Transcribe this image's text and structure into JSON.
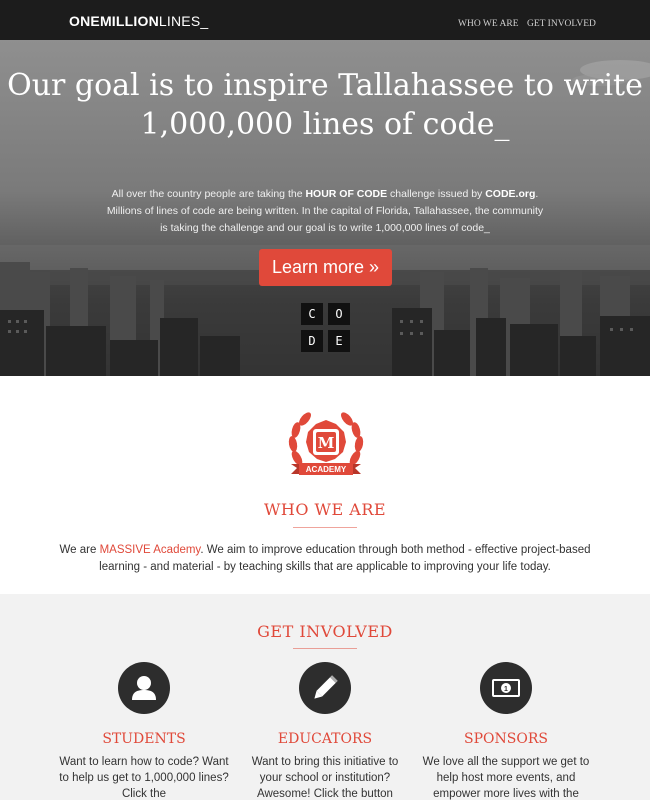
{
  "nav": {
    "brand_bold": "ONEMILLION",
    "brand_light": "LINES_",
    "links": [
      "WHO WE ARE",
      "GET INVOLVED"
    ]
  },
  "hero": {
    "title": "Our goal is to inspire Tallahassee to write 1,000,000 lines of code_",
    "text_parts": [
      "All over the country people are taking the ",
      "HOUR OF CODE",
      " challenge issued by ",
      "CODE.org",
      ". Millions of lines of code are being written. In the capital of Florida, Tallahassee, the community is taking the challenge and our goal is to write 1,000,000 lines of code_"
    ],
    "cta_label": "Learn more »",
    "code_letters": [
      "C",
      "O",
      "D",
      "E"
    ]
  },
  "who": {
    "badge_letter": "M",
    "badge_ribbon": "ACADEMY",
    "title": "WHO WE ARE",
    "text_before": "We are ",
    "text_link": "MASSIVE Academy",
    "text_after": ". We aim to improve education through both method - effective project-based learning - and material - by teaching skills that are applicable to improving your life today."
  },
  "involved": {
    "title": "GET INVOLVED",
    "columns": [
      {
        "icon": "user-icon",
        "title": "STUDENTS",
        "text": "Want to learn how to code? Want to help us get to 1,000,000 lines? Click the"
      },
      {
        "icon": "pencil-icon",
        "title": "EDUCATORS",
        "text": "Want to bring this initiative to your school or institution? Awesome! Click the button"
      },
      {
        "icon": "money-icon",
        "title": "SPONSORS",
        "text": "We love all the support we get to help host more events, and empower more lives with the"
      }
    ]
  },
  "colors": {
    "accent": "#e0493a",
    "nav_bg": "#1c1c1c",
    "icon_circle": "#2d2d2d",
    "section_bg": "#f2f2f2"
  }
}
